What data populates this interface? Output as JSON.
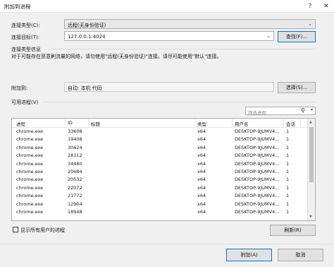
{
  "window": {
    "title": "附加到进程",
    "help": "?",
    "close": "✕"
  },
  "connection_type": {
    "label": "连接类型(C):",
    "value": "远程(无身份验证)"
  },
  "connection_target": {
    "label": "连接目标(T):",
    "value": "127.0.0.1:4024",
    "find_button": "查找(F)..."
  },
  "connection_info": {
    "heading": "连接类型信息",
    "text": "对于可能存在恶意刷流量的网络，请勿使用\"远程(无身份验证)\"连接。请尽可能使用\"默认\"连接。"
  },
  "attach_to": {
    "label": "附加到:",
    "value": "自动: 本机 代码",
    "select_button": "选择(S)..."
  },
  "processes": {
    "label": "可用进程(V)",
    "filter_placeholder": "筛选进程",
    "columns": [
      "进程",
      "ID",
      "标题",
      "类型",
      "用户名",
      "会话"
    ],
    "rows": [
      [
        "chrome.exe",
        "33608",
        "",
        "x64",
        "DESKTOP-9JUMV4...",
        "1"
      ],
      [
        "chrome.exe",
        "19408",
        "",
        "x64",
        "DESKTOP-9JUMV4...",
        "1"
      ],
      [
        "chrome.exe",
        "30624",
        "",
        "x64",
        "DESKTOP-9JUMV4...",
        "1"
      ],
      [
        "chrome.exe",
        "28112",
        "",
        "x64",
        "DESKTOP-9JUMV4...",
        "1"
      ],
      [
        "chrome.exe",
        "34480",
        "",
        "x64",
        "DESKTOP-9JUMV4...",
        "1"
      ],
      [
        "chrome.exe",
        "20684",
        "",
        "x64",
        "DESKTOP-9JUMV4...",
        "1"
      ],
      [
        "chrome.exe",
        "20532",
        "",
        "x64",
        "DESKTOP-9JUMV4...",
        "1"
      ],
      [
        "chrome.exe",
        "22072",
        "",
        "x64",
        "DESKTOP-9JUMV4...",
        "1"
      ],
      [
        "chrome.exe",
        "21772",
        "",
        "x64",
        "DESKTOP-9JUMV4...",
        "1"
      ],
      [
        "chrome.exe",
        "12904",
        "",
        "x64",
        "DESKTOP-9JUMV4...",
        "1"
      ],
      [
        "chrome.exe",
        "18948",
        "",
        "x64",
        "DESKTOP-9JUMV4...",
        "1"
      ]
    ],
    "show_all_label": "显示所有用户的进程",
    "refresh_button": "刷新(R)"
  },
  "footer": {
    "attach_button": "附加(A)",
    "cancel_button": "取消"
  }
}
